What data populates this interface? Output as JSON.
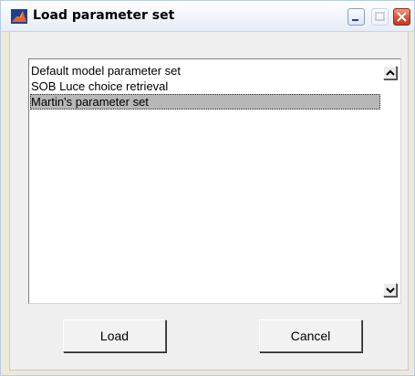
{
  "window": {
    "title": "Load parameter set",
    "controls": [
      "minimize-icon",
      "maximize-icon",
      "close-icon"
    ]
  },
  "list": {
    "items": [
      {
        "label": "Default model parameter set",
        "selected": false
      },
      {
        "label": "SOB Luce choice retrieval",
        "selected": false
      },
      {
        "label": "Martin's parameter set",
        "selected": true
      }
    ],
    "selection_color": "#b7b7b7"
  },
  "buttons": {
    "load_label": "Load",
    "cancel_label": "Cancel"
  },
  "colors": {
    "close_button": "#d4553a",
    "client_background": "#efefef"
  }
}
